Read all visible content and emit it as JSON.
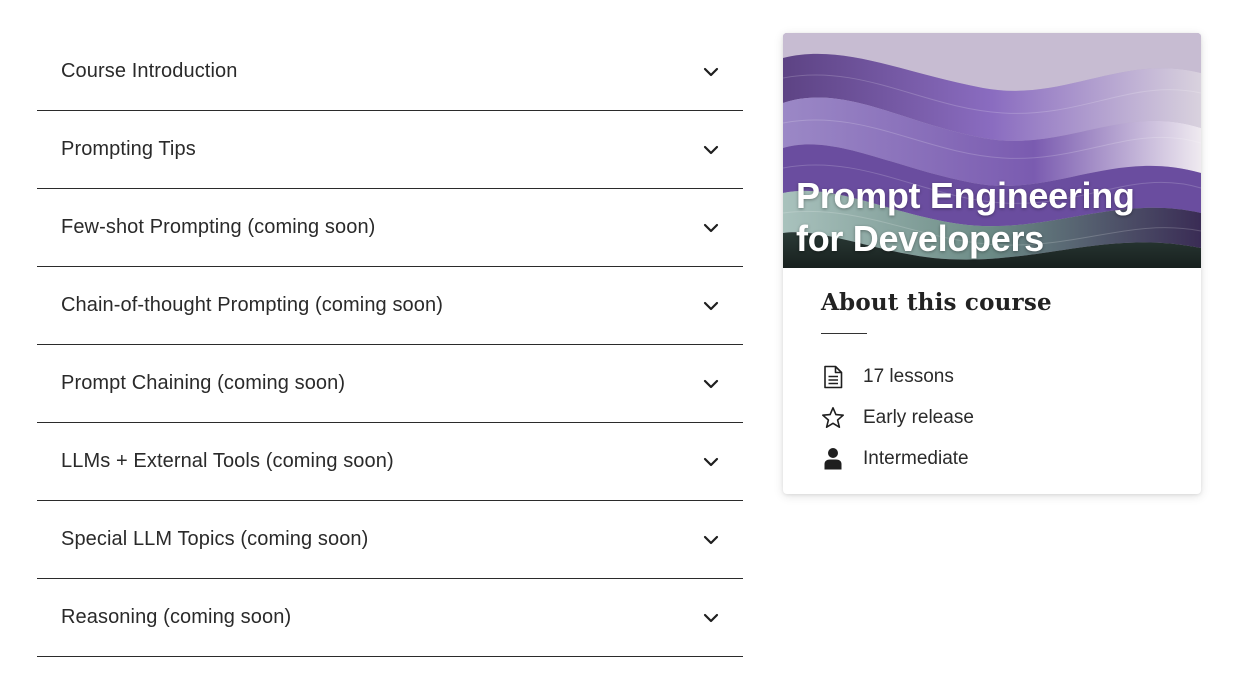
{
  "accordion": {
    "items": [
      {
        "label": "Course Introduction",
        "icon": "chevron-down-icon"
      },
      {
        "label": "Prompting Tips",
        "icon": "chevron-down-icon"
      },
      {
        "label": "Few-shot Prompting (coming soon)",
        "icon": "chevron-down-icon"
      },
      {
        "label": "Chain-of-thought Prompting (coming soon)",
        "icon": "chevron-down-icon"
      },
      {
        "label": "Prompt Chaining (coming soon)",
        "icon": "chevron-down-icon"
      },
      {
        "label": "LLMs + External Tools (coming soon)",
        "icon": "chevron-down-icon"
      },
      {
        "label": "Special LLM Topics (coming soon)",
        "icon": "chevron-down-icon"
      },
      {
        "label": "Reasoning (coming soon)",
        "icon": "chevron-down-icon"
      }
    ]
  },
  "course_card": {
    "hero_title_line1": "Prompt Engineering",
    "hero_title_line2": "for Developers",
    "about_heading": "About this course",
    "meta": [
      {
        "icon": "document-icon",
        "text": "17 lessons"
      },
      {
        "icon": "star-icon",
        "text": "Early release"
      },
      {
        "icon": "person-icon",
        "text": "Intermediate"
      }
    ]
  },
  "colors": {
    "divider": "#2b2b2b",
    "text": "#2a2a2a",
    "hero_purple": "#8a6fb5",
    "hero_teal": "#3c5a58"
  }
}
